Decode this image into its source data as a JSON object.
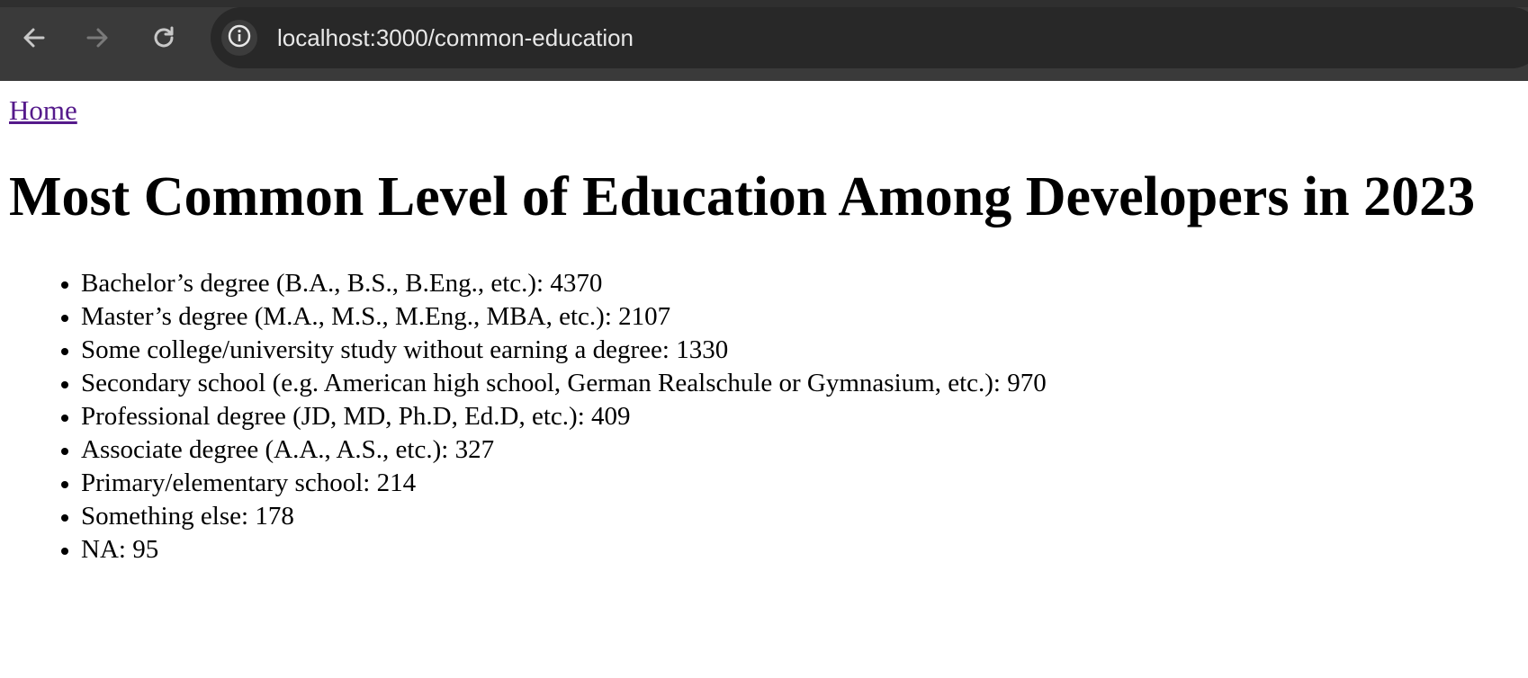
{
  "browser": {
    "url": "localhost:3000/common-education",
    "back_icon": "back-arrow-icon",
    "forward_icon": "forward-arrow-icon",
    "reload_icon": "reload-icon",
    "site_info_icon": "info-icon"
  },
  "nav": {
    "home_label": "Home"
  },
  "page": {
    "title": "Most Common Level of Education Among Developers in 2023"
  },
  "education": [
    {
      "level": "Bachelor’s degree (B.A., B.S., B.Eng., etc.)",
      "count": "4370"
    },
    {
      "level": "Master’s degree (M.A., M.S., M.Eng., MBA, etc.)",
      "count": "2107"
    },
    {
      "level": "Some college/university study without earning a degree",
      "count": "1330"
    },
    {
      "level": "Secondary school (e.g. American high school, German Realschule or Gymnasium, etc.)",
      "count": "970"
    },
    {
      "level": "Professional degree (JD, MD, Ph.D, Ed.D, etc.)",
      "count": "409"
    },
    {
      "level": "Associate degree (A.A., A.S., etc.)",
      "count": "327"
    },
    {
      "level": "Primary/elementary school",
      "count": "214"
    },
    {
      "level": "Something else",
      "count": "178"
    },
    {
      "level": "NA",
      "count": "95"
    }
  ],
  "colors": {
    "link_visited": "#551a8b",
    "toolbar_bg": "#3a3a3a",
    "omnibox_bg": "#282828"
  }
}
